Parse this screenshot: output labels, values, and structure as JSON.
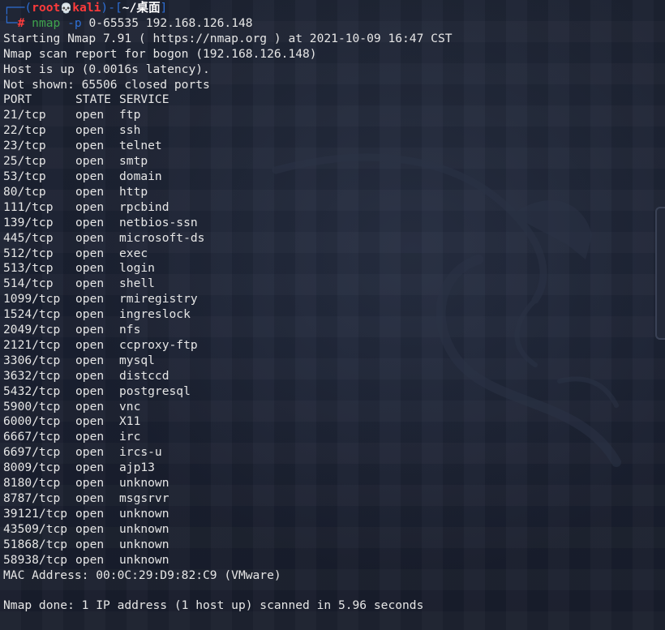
{
  "prompt": {
    "box_top": "┌──(",
    "user": "root",
    "skull": "💀",
    "host": "kali",
    "mid": ")-[",
    "dir": "~/桌面",
    "end": "]",
    "box_bottom": "└─",
    "hash": "#",
    "command": "nmap",
    "flag": "-p",
    "args": "0-65535 192.168.126.148"
  },
  "header_lines": [
    "Starting Nmap 7.91 ( https://nmap.org ) at 2021-10-09 16:47 CST",
    "Nmap scan report for bogon (192.168.126.148)",
    "Host is up (0.0016s latency).",
    "Not shown: 65506 closed ports"
  ],
  "table": {
    "headers": [
      "PORT",
      "STATE",
      "SERVICE"
    ],
    "rows": [
      [
        "21/tcp",
        "open",
        "ftp"
      ],
      [
        "22/tcp",
        "open",
        "ssh"
      ],
      [
        "23/tcp",
        "open",
        "telnet"
      ],
      [
        "25/tcp",
        "open",
        "smtp"
      ],
      [
        "53/tcp",
        "open",
        "domain"
      ],
      [
        "80/tcp",
        "open",
        "http"
      ],
      [
        "111/tcp",
        "open",
        "rpcbind"
      ],
      [
        "139/tcp",
        "open",
        "netbios-ssn"
      ],
      [
        "445/tcp",
        "open",
        "microsoft-ds"
      ],
      [
        "512/tcp",
        "open",
        "exec"
      ],
      [
        "513/tcp",
        "open",
        "login"
      ],
      [
        "514/tcp",
        "open",
        "shell"
      ],
      [
        "1099/tcp",
        "open",
        "rmiregistry"
      ],
      [
        "1524/tcp",
        "open",
        "ingreslock"
      ],
      [
        "2049/tcp",
        "open",
        "nfs"
      ],
      [
        "2121/tcp",
        "open",
        "ccproxy-ftp"
      ],
      [
        "3306/tcp",
        "open",
        "mysql"
      ],
      [
        "3632/tcp",
        "open",
        "distccd"
      ],
      [
        "5432/tcp",
        "open",
        "postgresql"
      ],
      [
        "5900/tcp",
        "open",
        "vnc"
      ],
      [
        "6000/tcp",
        "open",
        "X11"
      ],
      [
        "6667/tcp",
        "open",
        "irc"
      ],
      [
        "6697/tcp",
        "open",
        "ircs-u"
      ],
      [
        "8009/tcp",
        "open",
        "ajp13"
      ],
      [
        "8180/tcp",
        "open",
        "unknown"
      ],
      [
        "8787/tcp",
        "open",
        "msgsrvr"
      ],
      [
        "39121/tcp",
        "open",
        "unknown"
      ],
      [
        "43509/tcp",
        "open",
        "unknown"
      ],
      [
        "51868/tcp",
        "open",
        "unknown"
      ],
      [
        "58938/tcp",
        "open",
        "unknown"
      ]
    ]
  },
  "footer": {
    "mac": "MAC Address: 00:0C:29:D9:82:C9 (VMware)",
    "done": "Nmap done: 1 IP address (1 host up) scanned in 5.96 seconds"
  },
  "colors": {
    "background": "#1b2130",
    "prompt_box": "#2e6fd6",
    "user_host": "#ff3b3b",
    "command": "#3fa34d",
    "text": "#e6e6e6"
  },
  "icons": {
    "prompt_skull": "skull-icon",
    "background": "kali-dragon-icon"
  }
}
